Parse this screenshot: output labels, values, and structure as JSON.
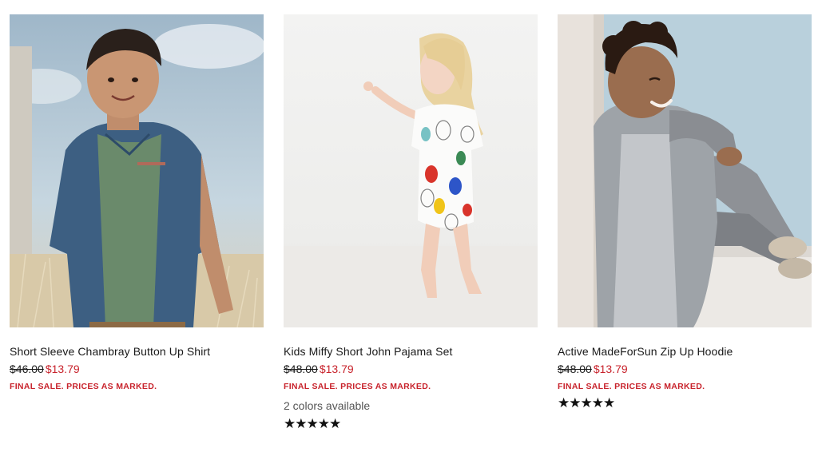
{
  "products": [
    {
      "name": "Short Sleeve Chambray Button Up Shirt",
      "original_price": "$46.00",
      "sale_price": "$13.79",
      "sale_note": "FINAL SALE. PRICES AS MARKED.",
      "colors_available": "",
      "rating_stars": ""
    },
    {
      "name": "Kids Miffy Short John Pajama Set",
      "original_price": "$48.00",
      "sale_price": "$13.79",
      "sale_note": "FINAL SALE. PRICES AS MARKED.",
      "colors_available": "2 colors available",
      "rating_stars": "★★★★★"
    },
    {
      "name": "Active MadeForSun Zip Up Hoodie",
      "original_price": "$48.00",
      "sale_price": "$13.79",
      "sale_note": "FINAL SALE. PRICES AS MARKED.",
      "colors_available": "",
      "rating_stars": "★★★★★"
    }
  ],
  "theme": {
    "sale_color": "#c8232c",
    "text_color": "#1a1a1a"
  }
}
